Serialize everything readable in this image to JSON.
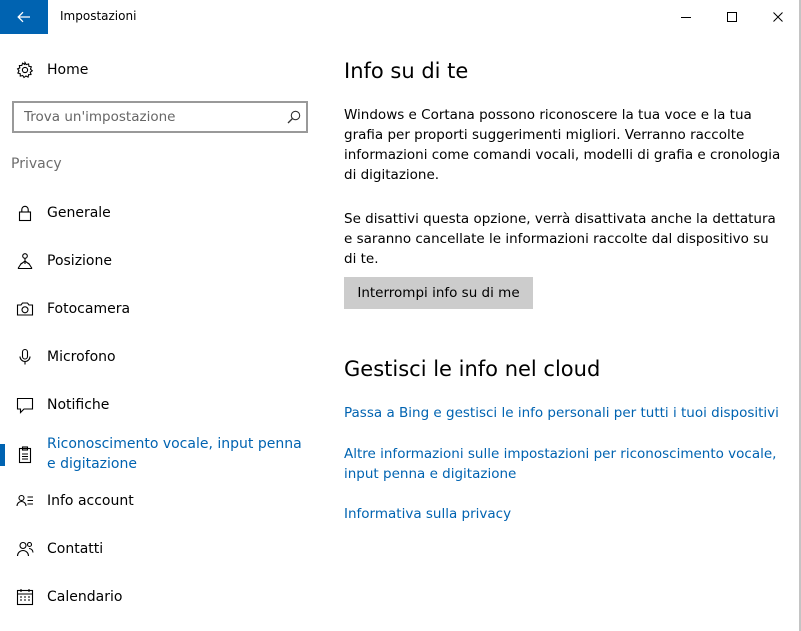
{
  "window": {
    "title": "Impostazioni"
  },
  "colors": {
    "accent": "#0063b1",
    "button_bg": "#cccccc",
    "muted_text": "#6d6d6d"
  },
  "sidebar": {
    "home_label": "Home",
    "search_placeholder": "Trova un'impostazione",
    "section_label": "Privacy",
    "items": [
      {
        "label": "Generale",
        "icon": "lock-icon",
        "active": false
      },
      {
        "label": "Posizione",
        "icon": "location-person-icon",
        "active": false
      },
      {
        "label": "Fotocamera",
        "icon": "camera-icon",
        "active": false
      },
      {
        "label": "Microfono",
        "icon": "microphone-icon",
        "active": false
      },
      {
        "label": "Notifiche",
        "icon": "notification-icon",
        "active": false
      },
      {
        "label": "Riconoscimento vocale, input penna e digitazione",
        "icon": "clipboard-icon",
        "active": true
      },
      {
        "label": "Info account",
        "icon": "account-info-icon",
        "active": false
      },
      {
        "label": "Contatti",
        "icon": "contacts-icon",
        "active": false
      },
      {
        "label": "Calendario",
        "icon": "calendar-icon",
        "active": false
      }
    ]
  },
  "main": {
    "heading1": "Info su di te",
    "para1": "Windows e Cortana possono riconoscere la tua voce e la tua grafia per proporti suggerimenti migliori. Verranno raccolte informazioni come comandi vocali, modelli di grafia e cronologia di digitazione.",
    "para2": "Se disattivi questa opzione, verrà disattivata anche la dettatura e saranno cancellate le informazioni raccolte dal dispositivo su di te.",
    "stop_button": "Interrompi info su di me",
    "heading2": "Gestisci le info nel cloud",
    "links": [
      "Passa a Bing e gestisci le info personali per tutti i tuoi dispositivi",
      "Altre informazioni sulle impostazioni per riconoscimento vocale, input penna e digitazione",
      "Informativa sulla privacy"
    ]
  }
}
